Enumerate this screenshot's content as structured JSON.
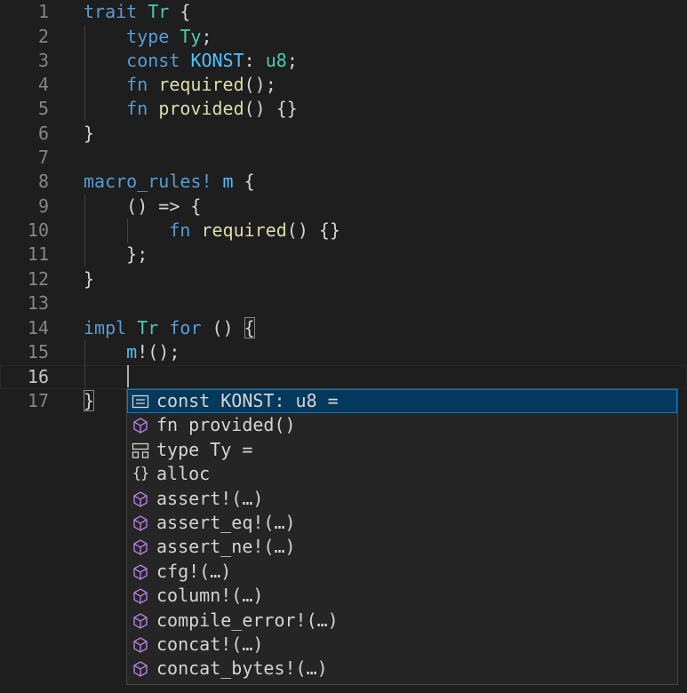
{
  "editor": {
    "lines": [
      {
        "n": "1",
        "tokens": [
          [
            "kw",
            "trait"
          ],
          [
            "pu",
            " "
          ],
          [
            "ty",
            "Tr"
          ],
          [
            "pu",
            " {"
          ]
        ]
      },
      {
        "n": "2",
        "tokens": [
          [
            "pu",
            "    "
          ],
          [
            "kw",
            "type"
          ],
          [
            "pu",
            " "
          ],
          [
            "ty",
            "Ty"
          ],
          [
            "pu",
            ";"
          ]
        ]
      },
      {
        "n": "3",
        "tokens": [
          [
            "pu",
            "    "
          ],
          [
            "kw",
            "const"
          ],
          [
            "pu",
            " "
          ],
          [
            "cst",
            "KONST"
          ],
          [
            "pu",
            ": "
          ],
          [
            "ty",
            "u8"
          ],
          [
            "pu",
            ";"
          ]
        ]
      },
      {
        "n": "4",
        "tokens": [
          [
            "pu",
            "    "
          ],
          [
            "kw",
            "fn"
          ],
          [
            "pu",
            " "
          ],
          [
            "fn",
            "required"
          ],
          [
            "pu",
            "();"
          ]
        ]
      },
      {
        "n": "5",
        "tokens": [
          [
            "pu",
            "    "
          ],
          [
            "kw",
            "fn"
          ],
          [
            "pu",
            " "
          ],
          [
            "fn",
            "provided"
          ],
          [
            "pu",
            "() {}"
          ]
        ]
      },
      {
        "n": "6",
        "tokens": [
          [
            "pu",
            "}"
          ]
        ]
      },
      {
        "n": "7",
        "tokens": []
      },
      {
        "n": "8",
        "tokens": [
          [
            "mac2",
            "macro_rules!"
          ],
          [
            "pu",
            " "
          ],
          [
            "mac",
            "m"
          ],
          [
            "pu",
            " {"
          ]
        ]
      },
      {
        "n": "9",
        "tokens": [
          [
            "pu",
            "    () => {"
          ]
        ]
      },
      {
        "n": "10",
        "tokens": [
          [
            "pu",
            "        "
          ],
          [
            "kw",
            "fn"
          ],
          [
            "pu",
            " "
          ],
          [
            "fn",
            "required"
          ],
          [
            "pu",
            "() {}"
          ]
        ]
      },
      {
        "n": "11",
        "tokens": [
          [
            "pu",
            "    };"
          ]
        ]
      },
      {
        "n": "12",
        "tokens": [
          [
            "pu",
            "}"
          ]
        ]
      },
      {
        "n": "13",
        "tokens": []
      },
      {
        "n": "14",
        "tokens": [
          [
            "kw",
            "impl"
          ],
          [
            "pu",
            " "
          ],
          [
            "ty",
            "Tr"
          ],
          [
            "pu",
            " "
          ],
          [
            "kw",
            "for"
          ],
          [
            "pu",
            " () "
          ],
          [
            "hl",
            "{"
          ]
        ]
      },
      {
        "n": "15",
        "tokens": [
          [
            "pu",
            "    "
          ],
          [
            "mac",
            "m"
          ],
          [
            "pu",
            "!();"
          ]
        ]
      },
      {
        "n": "16",
        "tokens": []
      },
      {
        "n": "17",
        "tokens": [
          [
            "hl",
            "}"
          ]
        ]
      }
    ]
  },
  "suggest": {
    "items": [
      {
        "label": "const KONST: u8 =",
        "icon": "constant-icon",
        "selected": true
      },
      {
        "label": "fn provided()",
        "icon": "method-cube-icon"
      },
      {
        "label": "type Ty =",
        "icon": "type-alias-icon"
      },
      {
        "label": "alloc",
        "icon": "module-braces-icon"
      },
      {
        "label": "assert!(…)",
        "icon": "method-cube-icon"
      },
      {
        "label": "assert_eq!(…)",
        "icon": "method-cube-icon"
      },
      {
        "label": "assert_ne!(…)",
        "icon": "method-cube-icon"
      },
      {
        "label": "cfg!(…)",
        "icon": "method-cube-icon"
      },
      {
        "label": "column!(…)",
        "icon": "method-cube-icon"
      },
      {
        "label": "compile_error!(…)",
        "icon": "method-cube-icon"
      },
      {
        "label": "concat!(…)",
        "icon": "method-cube-icon"
      },
      {
        "label": "concat_bytes!(…)",
        "icon": "method-cube-icon"
      }
    ]
  },
  "colors": {
    "background": "#1e1e1e",
    "keyword": "#569cd6",
    "type": "#4ec9b0",
    "function": "#dcdcaa",
    "selection": "#04395e",
    "icon_purple": "#b180d7"
  }
}
